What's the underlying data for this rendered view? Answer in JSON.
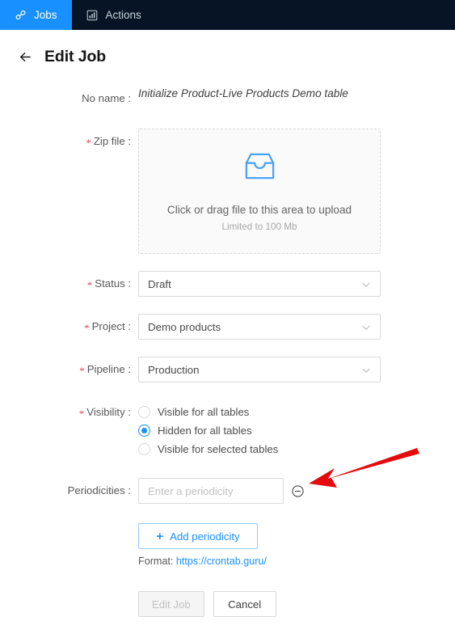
{
  "nav": {
    "tabs": [
      {
        "label": "Jobs",
        "icon": "link-icon",
        "active": true
      },
      {
        "label": "Actions",
        "icon": "bar-chart-icon",
        "active": false
      }
    ]
  },
  "header": {
    "back_icon": "arrow-left-icon",
    "title": "Edit Job"
  },
  "form": {
    "name": {
      "label": "No name :",
      "value": "Initialize Product-Live Products Demo table"
    },
    "zip_file": {
      "label": "Zip file :",
      "required": true,
      "icon": "inbox-icon",
      "primary_text": "Click or drag file to this area to upload",
      "secondary_text": "Limited to 100 Mb"
    },
    "status": {
      "label": "Status :",
      "required": true,
      "value": "Draft"
    },
    "project": {
      "label": "Project :",
      "required": true,
      "value": "Demo products"
    },
    "pipeline": {
      "label": "Pipeline :",
      "required": true,
      "value": "Production"
    },
    "visibility": {
      "label": "Visibility :",
      "required": true,
      "options": [
        {
          "label": "Visible for all tables",
          "checked": false
        },
        {
          "label": "Hidden for all tables",
          "checked": true
        },
        {
          "label": "Visible for selected tables",
          "checked": false
        }
      ]
    },
    "periodicities": {
      "label": "Periodicities :",
      "required": false,
      "value": "",
      "placeholder": "Enter a periodicity",
      "remove_icon": "minus-circle-icon",
      "add_button": "Add periodicity",
      "add_icon": "plus-icon",
      "format_prefix": "Format:",
      "format_link": "https://crontab.guru/"
    }
  },
  "footer": {
    "submit_label": "Edit Job",
    "cancel_label": "Cancel"
  },
  "colors": {
    "accent": "#1890ff",
    "nav_background": "#061426",
    "required_marker": "#e0495a",
    "annotation": "#e30b0b"
  }
}
